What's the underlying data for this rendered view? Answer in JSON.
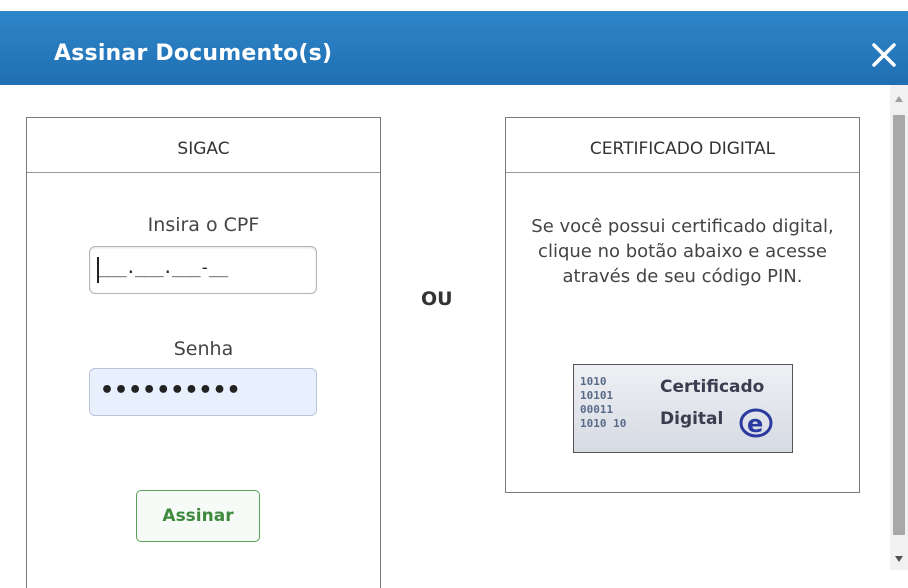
{
  "dialog": {
    "title": "Assinar Documento(s)",
    "close_icon": "close-icon",
    "accent_color": "#2074b8"
  },
  "sigac": {
    "header": "SIGAC",
    "cpf_label": "Insira o CPF",
    "cpf_value": "___.___.___-__",
    "senha_label": "Senha",
    "senha_value": "••••••••••",
    "submit_label": "Assinar"
  },
  "separator": "OU",
  "certificado": {
    "header": "CERTIFICADO DIGITAL",
    "description": "Se você possui certificado digital, clique no botão abaixo e acesse através de seu código PIN.",
    "button_line1": "Certificado",
    "button_line2": "Digital",
    "button_icon": "e-icon"
  }
}
